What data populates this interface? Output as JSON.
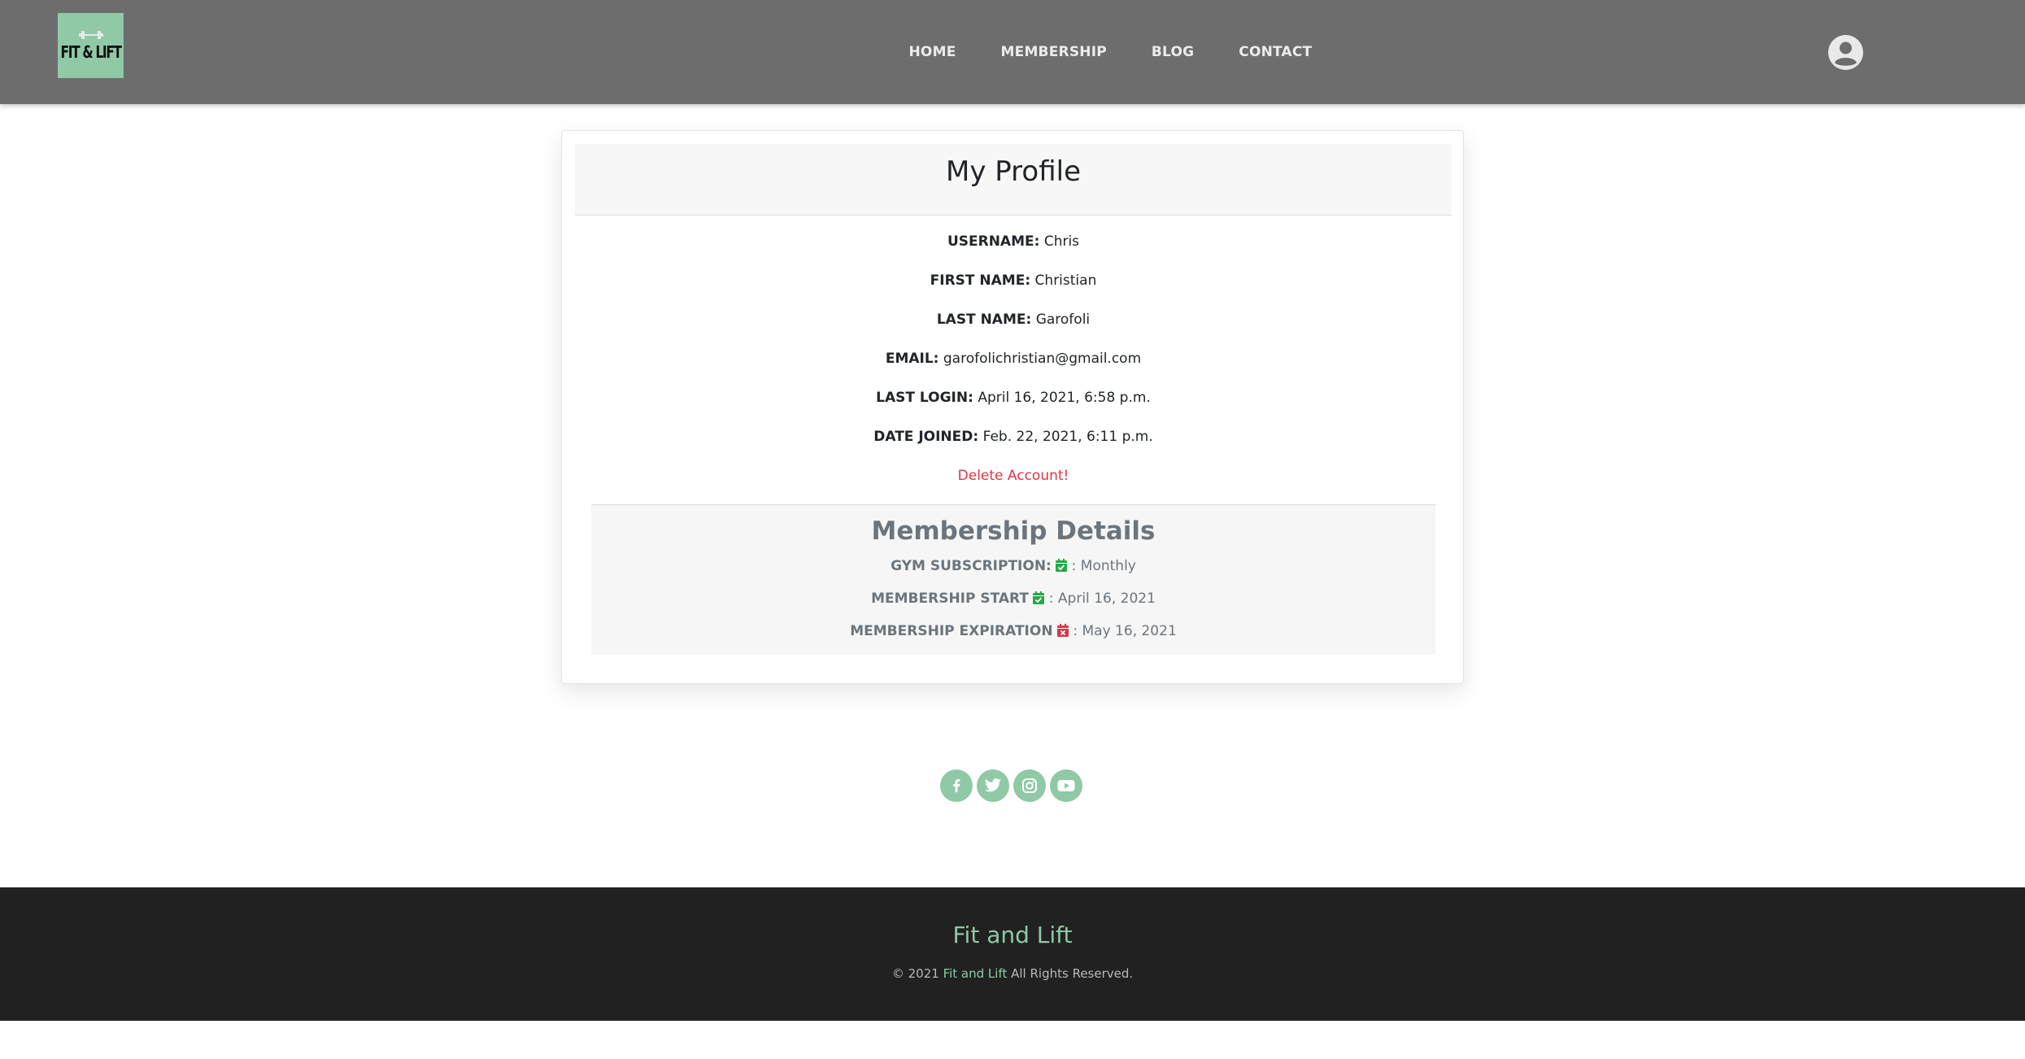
{
  "header": {
    "logo_text": "FIT & LIFT",
    "nav": [
      "HOME",
      "MEMBERSHIP",
      "BLOG",
      "CONTACT"
    ],
    "user_icon": "user-circle-icon"
  },
  "profile": {
    "title": "My Profile",
    "fields": [
      {
        "label": "USERNAME:",
        "value": "Chris"
      },
      {
        "label": "FIRST NAME:",
        "value": "Christian"
      },
      {
        "label": "LAST NAME:",
        "value": "Garofoli"
      },
      {
        "label": "EMAIL:",
        "value": "garofolichristian@gmail.com"
      },
      {
        "label": "LAST LOGIN:",
        "value": "April 16, 2021, 6:58 p.m."
      },
      {
        "label": "DATE JOINED:",
        "value": "Feb. 22, 2021, 6:11 p.m."
      }
    ],
    "delete_label": "Delete Account!"
  },
  "membership": {
    "title": "Membership Details",
    "rows": [
      {
        "label": "GYM SUBSCRIPTION:",
        "icon": "calendar-check-icon",
        "value": ": Monthly"
      },
      {
        "label": "MEMBERSHIP START",
        "icon": "calendar-check-icon",
        "value": ": April 16, 2021"
      },
      {
        "label": "MEMBERSHIP EXPIRATION",
        "icon": "calendar-times-icon",
        "value": ": May 16, 2021"
      }
    ]
  },
  "social": [
    "facebook-icon",
    "twitter-icon",
    "instagram-icon",
    "youtube-icon"
  ],
  "footer": {
    "title": "Fit and Lift",
    "copy_prefix": "© 2021",
    "copy_link": "Fit and Lift",
    "copy_suffix": "All Rights Reserved."
  },
  "colors": {
    "accent": "#8fc9a5",
    "header_bg": "#6d6d6d",
    "footer_bg": "#212121",
    "danger": "#dc3545",
    "check_green": "#28a745"
  }
}
